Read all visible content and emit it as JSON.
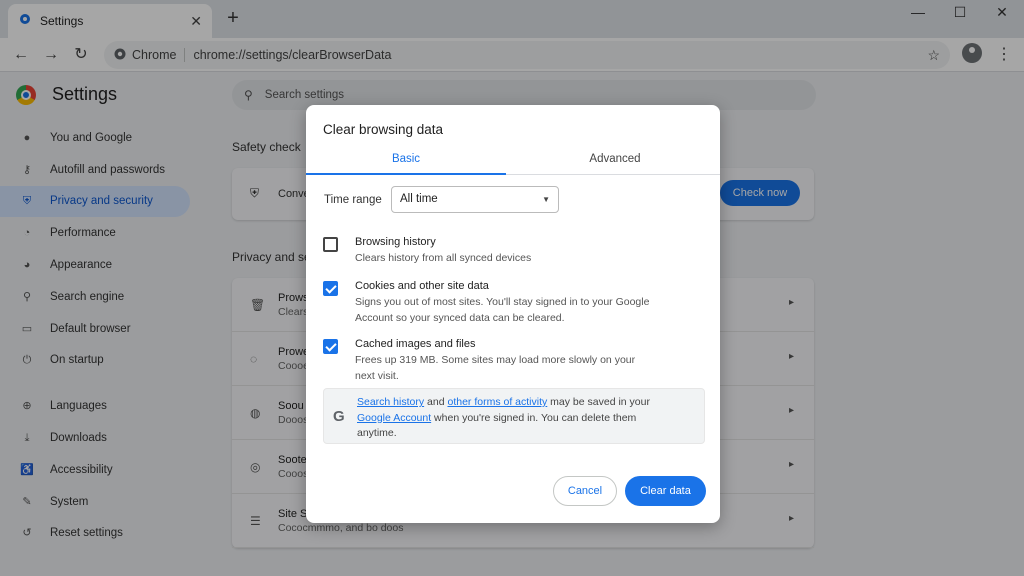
{
  "browser": {
    "tab_title": "Settings",
    "tab_close": "✕",
    "new_tab": "+",
    "window_controls": {
      "minimize": "—",
      "maximize": "☐",
      "close": "✕"
    },
    "nav": {
      "back": "←",
      "forward": "→",
      "reload": "↻"
    },
    "omnibox": {
      "site_label": "Chrome",
      "url": "chrome://settings/clearBrowserData",
      "bookmark_icon": "☆"
    },
    "menu_icon": "⋮"
  },
  "settings": {
    "title": "Settings",
    "search_placeholder": "Search settings",
    "sidebar": {
      "items": [
        {
          "label": "You and Google",
          "icon": "person-icon",
          "glyph": "●"
        },
        {
          "label": "Autofill and passwords",
          "icon": "key-icon",
          "glyph": "⚷"
        },
        {
          "label": "Privacy and security",
          "icon": "shield-icon",
          "glyph": "⛨",
          "active": true
        },
        {
          "label": "Performance",
          "icon": "speedometer-icon",
          "glyph": "◔"
        },
        {
          "label": "Appearance",
          "icon": "palette-icon",
          "glyph": "◕"
        },
        {
          "label": "Search engine",
          "icon": "search-icon",
          "glyph": "⚲"
        },
        {
          "label": "Default browser",
          "icon": "browser-icon",
          "glyph": "▭"
        },
        {
          "label": "On startup",
          "icon": "power-icon",
          "glyph": "⏻"
        },
        {
          "label": "Languages",
          "icon": "globe-icon",
          "glyph": "⊕"
        },
        {
          "label": "Downloads",
          "icon": "download-icon",
          "glyph": "⤓"
        },
        {
          "label": "Accessibility",
          "icon": "accessibility-icon",
          "glyph": "♿"
        },
        {
          "label": "System",
          "icon": "wrench-icon",
          "glyph": "✎"
        },
        {
          "label": "Reset settings",
          "icon": "history-icon",
          "glyph": "↺"
        }
      ]
    },
    "safety_check": {
      "heading": "Safety check",
      "text": "Conve",
      "button": "Check now"
    },
    "privacy": {
      "heading": "Privacy and se",
      "rows": [
        {
          "title": "Prows",
          "sub": "Clears",
          "icon": "trash-icon",
          "glyph": "🗑"
        },
        {
          "title": "Prowe",
          "sub": "Coooe",
          "icon": "cookie-icon",
          "glyph": "◌"
        },
        {
          "title": "Soou",
          "sub": "Dooos",
          "icon": "security-icon",
          "glyph": "◍"
        },
        {
          "title": "Soote",
          "sub": "Cooos",
          "icon": "site-icon",
          "glyph": "◎"
        },
        {
          "title": "Site S",
          "sub": "Cococmmmo, and bo doos",
          "icon": "tune-icon",
          "glyph": "☰"
        }
      ],
      "chevron": "▸"
    }
  },
  "dialog": {
    "title": "Clear browsing data",
    "tabs": [
      "Basic",
      "Advanced"
    ],
    "time_range": {
      "label": "Time range",
      "value": "All time",
      "caret": "▼"
    },
    "options": [
      {
        "title": "Browsing history",
        "desc": "Clears history from all synced devices",
        "checked": false
      },
      {
        "title": "Cookies and other site data",
        "desc": "Signs you out of most sites. You'll stay signed in to your Google Account so your synced data can be cleared.",
        "checked": true
      },
      {
        "title": "Cached images and files",
        "desc": "Frees up 319 MB. Some sites may load more slowly on your next visit.",
        "checked": true
      }
    ],
    "google_note": {
      "icon": "G",
      "link1": "Search history",
      "and": " and ",
      "link2": "other forms of activity",
      "text1": " may be saved in your ",
      "link3": "Google Account",
      "text2": " when you're signed in. You can delete them anytime."
    },
    "cancel_label": "Cancel",
    "clear_label": "Clear data"
  },
  "colors": {
    "accent": "#1a73e8",
    "active_nav_bg": "#d3e3fd"
  }
}
